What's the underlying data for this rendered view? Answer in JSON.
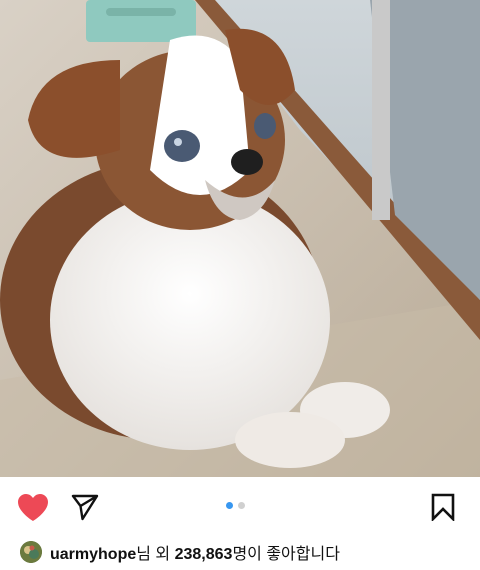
{
  "post": {
    "image_alt": "Brown and white dog lying on a wooden floor by a window",
    "carousel": {
      "count": 2,
      "active_index": 0
    },
    "likes": {
      "user": "uarmyhope",
      "suffix_1": "님 외 ",
      "count": "238,863",
      "suffix_2": "명이 좋아합니다"
    }
  },
  "icons": {
    "like": "heart-filled-icon",
    "share": "paper-plane-icon",
    "save": "bookmark-icon"
  },
  "colors": {
    "like_red": "#ed4956",
    "dot_active": "#3897f0",
    "dot_inactive": "#d0d0d0"
  }
}
